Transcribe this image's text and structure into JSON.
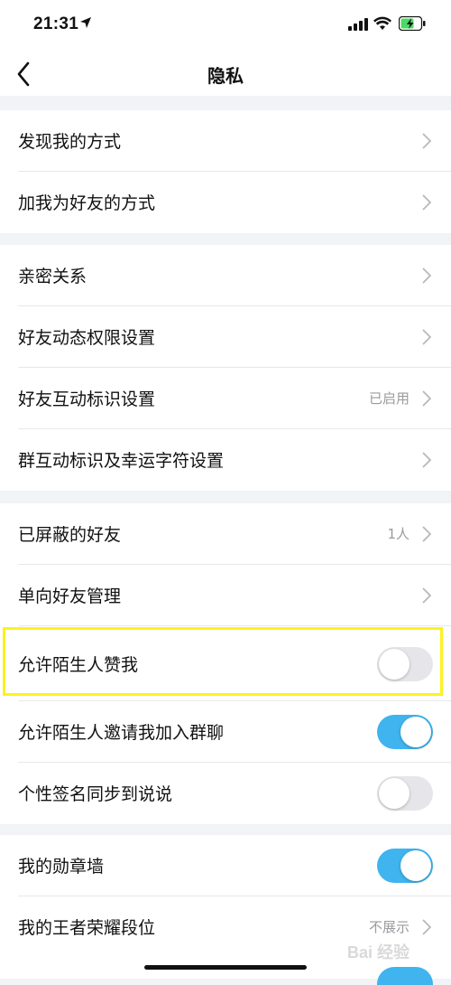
{
  "status_bar": {
    "time": "21:31"
  },
  "nav": {
    "title": "隐私"
  },
  "groups": [
    {
      "rows": [
        {
          "label": "发现我的方式"
        },
        {
          "label": "加我为好友的方式"
        }
      ]
    },
    {
      "rows": [
        {
          "label": "亲密关系"
        },
        {
          "label": "好友动态权限设置"
        },
        {
          "label": "好友互动标识设置",
          "value": "已启用"
        },
        {
          "label": "群互动标识及幸运字符设置"
        }
      ]
    },
    {
      "rows": [
        {
          "label": "已屏蔽的好友",
          "value": "1人"
        },
        {
          "label": "单向好友管理"
        },
        {
          "label": "允许陌生人赞我",
          "toggle": "off"
        },
        {
          "label": "允许陌生人邀请我加入群聊",
          "toggle": "on"
        },
        {
          "label": "个性签名同步到说说",
          "toggle": "off"
        }
      ]
    },
    {
      "rows": [
        {
          "label": "我的勋章墙",
          "toggle": "on"
        },
        {
          "label": "我的王者荣耀段位",
          "value": "不展示"
        }
      ]
    }
  ],
  "watermark": "Bai 经验",
  "colors": {
    "toggle_on": "#3fb4ee",
    "highlight": "#fbf21e",
    "background": "#f2f3f6"
  }
}
